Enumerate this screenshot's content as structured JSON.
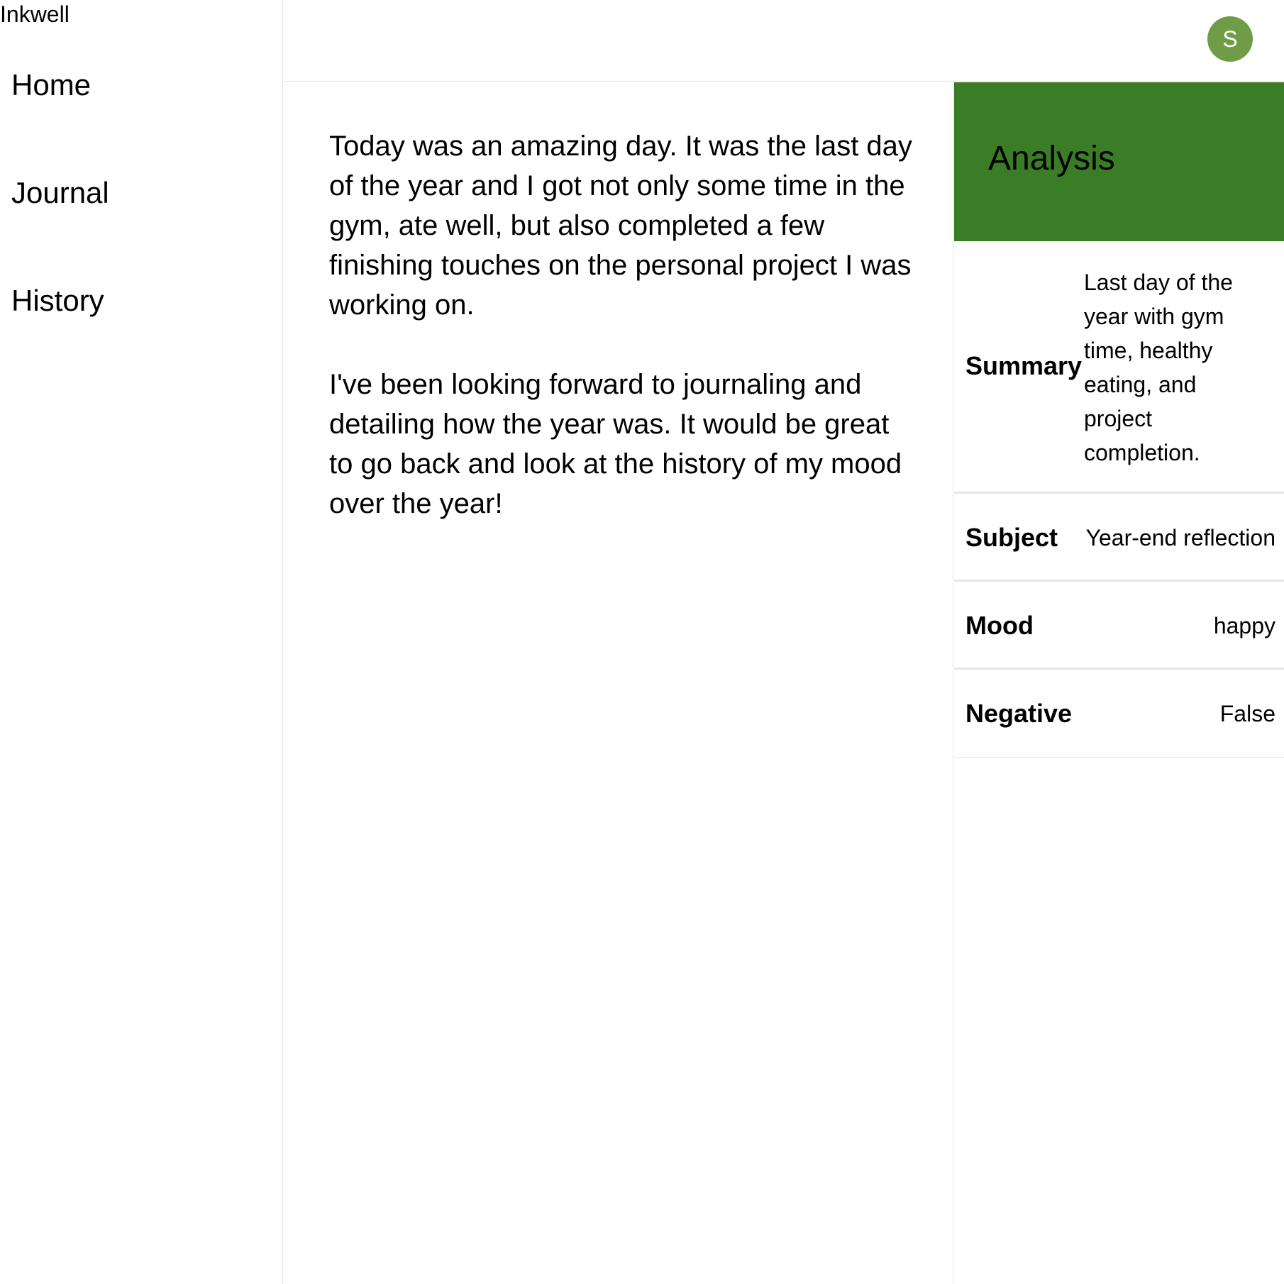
{
  "app": {
    "brand": "Inkwell"
  },
  "sidebar": {
    "items": [
      {
        "label": "Home"
      },
      {
        "label": "Journal"
      },
      {
        "label": "History"
      }
    ]
  },
  "header": {
    "avatar_initial": "S",
    "avatar_color": "#6f9c47"
  },
  "editor": {
    "content": "Today was an amazing day. It was the last day of the year and I got not only some time in the gym, ate well, but also completed a few finishing touches on the personal project I was working on.\n\nI've been looking forward to journaling and detailing how the year was. It would be great to go back and look at the history of my mood over the year!"
  },
  "analysis": {
    "title": "Analysis",
    "header_color": "#3a7d26",
    "fields": [
      {
        "label": "Summary",
        "value": "Last day of the year with gym time, healthy eating, and project completion."
      },
      {
        "label": "Subject",
        "value": "Year-end reflection"
      },
      {
        "label": "Mood",
        "value": "happy"
      },
      {
        "label": "Negative",
        "value": "False"
      }
    ]
  }
}
